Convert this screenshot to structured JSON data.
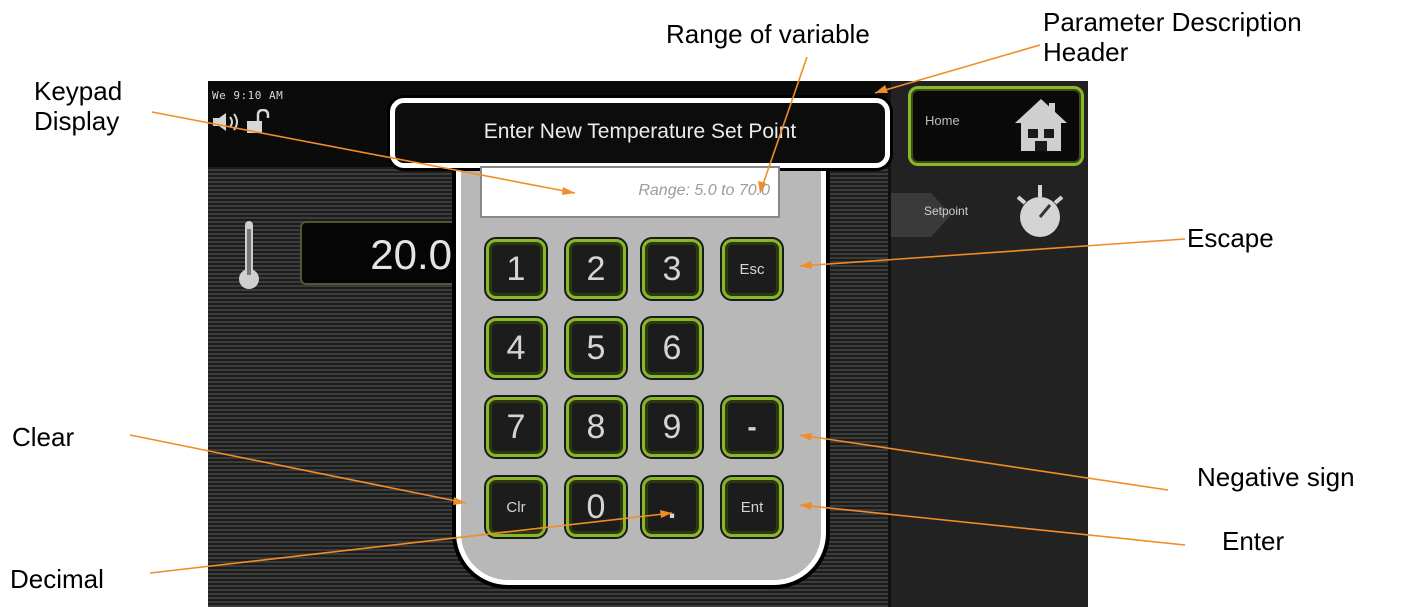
{
  "status": {
    "time": "We 9:10 AM"
  },
  "main": {
    "current_temperature": "20.0"
  },
  "nav": {
    "home_label": "Home",
    "setpoint_label": "Setpoint"
  },
  "keypad": {
    "header": "Enter New Temperature Set Point",
    "range_hint": "Range: 5.0 to 70.0",
    "keys": {
      "k1": "1",
      "k2": "2",
      "k3": "3",
      "esc": "Esc",
      "k4": "4",
      "k5": "5",
      "k6": "6",
      "k7": "7",
      "k8": "8",
      "k9": "9",
      "minus": "-",
      "clr": "Clr",
      "k0": "0",
      "dot": ".",
      "ent": "Ent"
    }
  },
  "annotations": {
    "range_of_variable": "Range of variable",
    "parameter_description_header": "Parameter Description\nHeader",
    "keypad_display": "Keypad\nDisplay",
    "escape": "Escape",
    "clear": "Clear",
    "negative_sign": "Negative sign",
    "enter": "Enter",
    "decimal": "Decimal"
  },
  "colors": {
    "key_border": "#88b82a",
    "callout_line": "#f28c28",
    "screen_bg": "#2a2a2a"
  }
}
